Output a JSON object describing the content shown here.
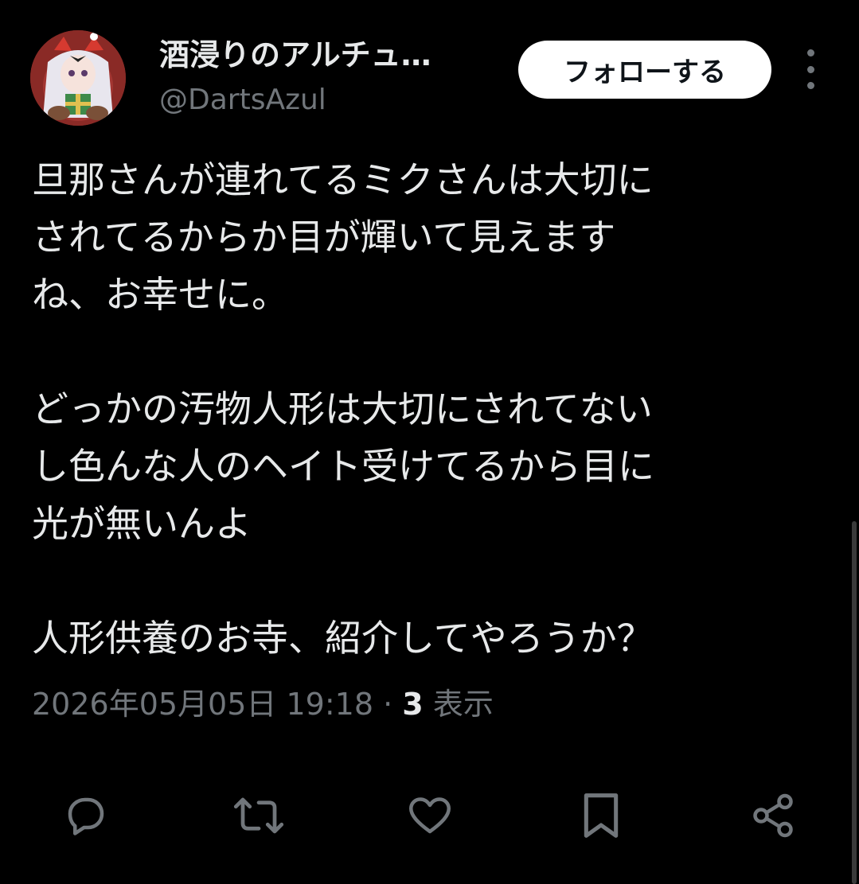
{
  "user": {
    "display_name": "酒浸りのアルチュ…",
    "handle": "@DartsAzul"
  },
  "follow_button": {
    "label": "フォローする"
  },
  "post": {
    "paragraphs": [
      "旦那さんが連れてるミクさんは大切に\nされてるからか目が輝いて見えます\nね、お幸せに。",
      "どっかの汚物人形は大切にされてない\nし色んな人のヘイト受けてるから目に\n光が無いんよ",
      "人形供養のお寺、紹介してやろうか？"
    ],
    "timestamp": "2026年05月05日 19:18",
    "separator": "·",
    "view_count": "3",
    "view_label": "表示"
  },
  "icons": {
    "avatar": "avatar-image",
    "more": "more-vertical-icon",
    "reply": "reply-icon",
    "retweet": "retweet-icon",
    "like": "heart-icon",
    "bookmark": "bookmark-icon",
    "share": "share-icon"
  },
  "colors": {
    "background": "#000000",
    "text": "#e7e9ea",
    "secondary": "#71767b",
    "button_bg": "#ffffff"
  }
}
